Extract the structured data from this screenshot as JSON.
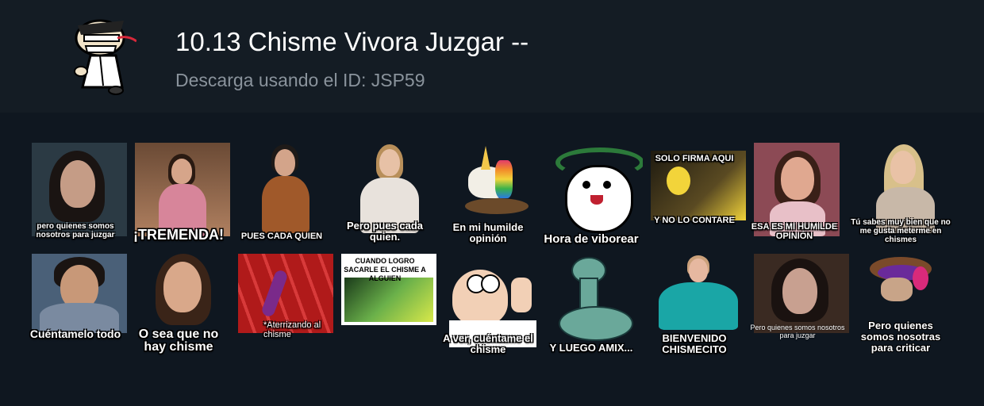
{
  "header": {
    "title": "10.13 Chisme Vivora Juzgar --",
    "subtitle": "Descarga usando el ID: JSP59",
    "icon": "cartoon-man-icon"
  },
  "stickers": [
    {
      "caption": "pero quienes somos nosotros para juzgar",
      "bg": "#2b3a44"
    },
    {
      "caption": "¡TREMENDA!",
      "bg": "#7a5640"
    },
    {
      "caption": "PUES CADA QUIEN",
      "bg": "#0f1720"
    },
    {
      "caption": "Pero pues cada quien.",
      "bg": "#0f1720"
    },
    {
      "caption": "En mi humilde opinión",
      "bg": "#0f1720"
    },
    {
      "caption": "Hora de viborear",
      "bg": "#0f1720"
    },
    {
      "caption": "SOLO FIRMA AQUI",
      "caption2": "Y NO LO CONTARE",
      "bg": "#3a3020"
    },
    {
      "caption": "ESA ES MI HUMILDE OPINIÓN",
      "bg": "#8c4a55"
    },
    {
      "caption": "Tú sabes muy bien que no me gusta meterme en chismes",
      "bg": "#0f1720"
    },
    {
      "caption": "Cuéntamelo todo",
      "bg": "#4a6078"
    },
    {
      "caption": "O sea que no hay chisme",
      "bg": "#0f1720"
    },
    {
      "caption": "*Aterrizando al chisme",
      "bg": "#b01a1a"
    },
    {
      "caption": "CUANDO LOGRO SACARLE EL CHISME A ALGUIEN",
      "bg": "#ffffff"
    },
    {
      "caption": "A ver, cuéntame el chisme",
      "bg": "#0f1720"
    },
    {
      "caption": "Y LUEGO AMIX...",
      "bg": "#0f1720"
    },
    {
      "caption": "BIENVENIDO CHISMECITO",
      "bg": "#0f1720"
    },
    {
      "caption": "Pero quienes somos nosotros para juzgar",
      "bg": "#3a2a22"
    },
    {
      "caption": "Pero quienes somos nosotras para criticar",
      "bg": "#0f1720"
    }
  ]
}
